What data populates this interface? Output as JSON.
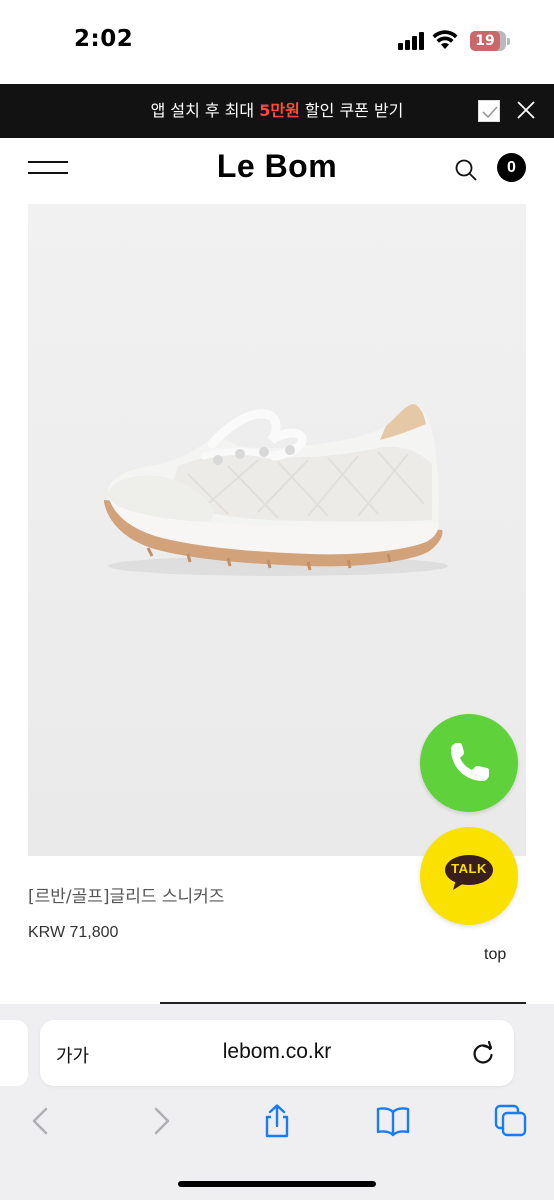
{
  "status_bar": {
    "time": "2:02",
    "battery": "19",
    "battery_color": "#c9686a"
  },
  "promo": {
    "text_before": "앱 설치 후 최대 ",
    "highlight": "5만원",
    "text_after": " 할인 쿠폰 받기",
    "highlight_color": "#ff4a3d",
    "check_icon": "checkbox-icon",
    "close_icon": "close-icon"
  },
  "header": {
    "logo": "Le Bom",
    "cart_count": "0",
    "menu_icon": "hamburger-menu-icon",
    "search_icon": "search-icon"
  },
  "product": {
    "image_icon": "white-sneaker-image",
    "name": "[르반/골프]글리드 스니커즈",
    "price": "KRW 71,800"
  },
  "floating": {
    "call_icon": "phone-icon",
    "call_color": "#5fd13b",
    "talk_label": "TALK",
    "talk_color": "#fae100",
    "top_label": "top"
  },
  "browser": {
    "text_size_label": "가가",
    "url": "lebom.co.kr",
    "reload_icon": "reload-icon",
    "back_icon": "chevron-left-icon",
    "forward_icon": "chevron-right-icon",
    "share_icon": "share-icon",
    "bookmarks_icon": "book-icon",
    "tabs_icon": "tabs-icon"
  }
}
